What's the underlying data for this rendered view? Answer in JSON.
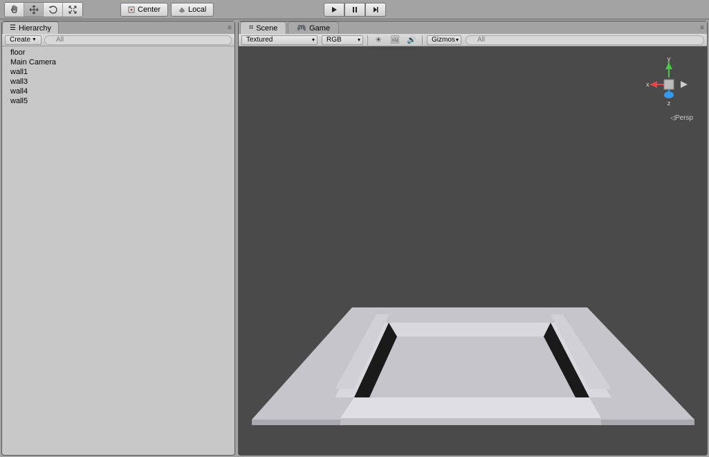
{
  "toolbar": {
    "center_label": "Center",
    "local_label": "Local"
  },
  "hierarchy": {
    "tab_label": "Hierarchy",
    "create_label": "Create",
    "search_placeholder": "All",
    "items": [
      "floor",
      "Main Camera",
      "wall1",
      "wall3",
      "wall4",
      "wall5"
    ]
  },
  "scene": {
    "scene_tab": "Scene",
    "game_tab": "Game",
    "render_mode": "Textured",
    "color_mode": "RGB",
    "gizmos_label": "Gizmos",
    "search_placeholder": "All",
    "persp_label": "Persp",
    "axes": {
      "x": "x",
      "y": "y",
      "z": "z"
    }
  }
}
